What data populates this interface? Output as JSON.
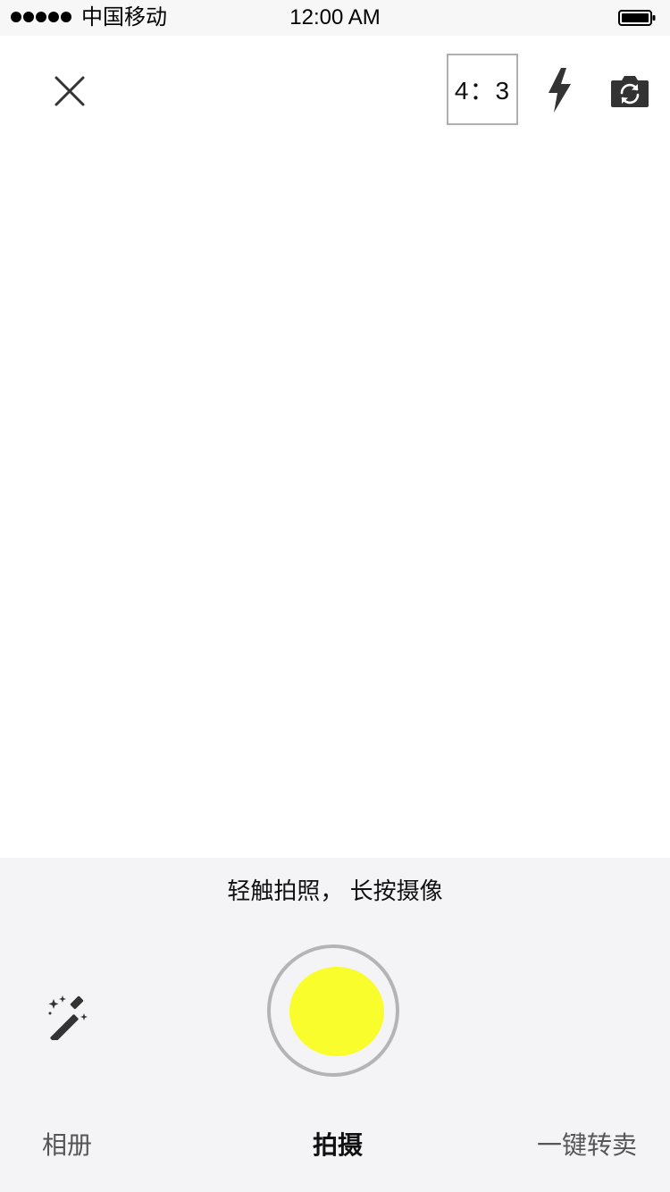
{
  "status_bar": {
    "carrier": "中国移动",
    "time": "12:00 AM",
    "signal_icon": "signal-dots-icon",
    "battery_icon": "battery-icon"
  },
  "top_controls": {
    "close_icon": "close-icon",
    "aspect_ratio": "4：3",
    "flash_icon": "flash-icon",
    "switch_camera_icon": "camera-switch-icon"
  },
  "hint": "轻触拍照， 长按摄像",
  "shutter": {
    "color": "#fafd2c",
    "ring_color": "#b4b4b4"
  },
  "magic_icon": "magic-wand-icon",
  "modes": {
    "album": "相册",
    "shoot": "拍摄",
    "sell": "一键转卖"
  },
  "colors": {
    "panel_background": "#f4f3f6",
    "status_bar_background": "#f7f7f7"
  }
}
